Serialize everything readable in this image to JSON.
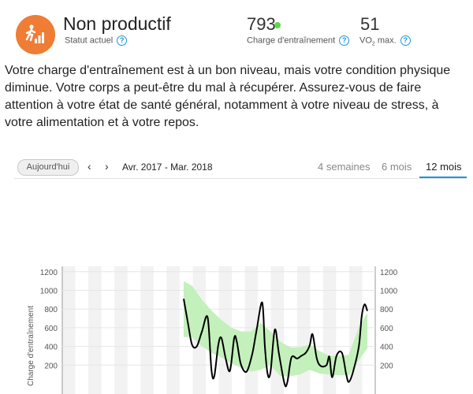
{
  "status": {
    "title": "Non productif",
    "subtitle": "Statut actuel",
    "help": "?"
  },
  "training_load": {
    "value": "793",
    "label": "Charge d'entraînement",
    "dot_color": "#5cd84c",
    "help": "?"
  },
  "vo2": {
    "value": "51",
    "label_prefix": "VO",
    "label_sub": "2",
    "label_suffix": " max.",
    "help": "?"
  },
  "description": "Votre charge d'entraînement est à un bon niveau, mais votre condition physique diminue. Votre corps a peut-être du mal à récupérer. Assurez-vous de faire attention à votre état de santé général, notamment à votre niveau de stress, à votre alimentation et à votre repos.",
  "toolbar": {
    "today_label": "Aujourd'hui",
    "prev_icon": "‹",
    "next_icon": "›",
    "range_label": "Avr. 2017 - Mar. 2018",
    "tabs": [
      {
        "label": "4 semaines",
        "active": false
      },
      {
        "label": "6 mois",
        "active": false
      },
      {
        "label": "12 mois",
        "active": true
      }
    ]
  },
  "chart_data": {
    "type": "line",
    "ylabel": "Charge d'entraînement",
    "ylim": [
      0,
      1300
    ],
    "y_ticks": [
      200,
      400,
      600,
      800,
      1000,
      1200
    ],
    "grid": true,
    "line_color": "#000000",
    "band_color": "#c3f0bb",
    "series": [
      {
        "values": [
          {
            "x": 0.0,
            "y": 910
          },
          {
            "x": 0.018,
            "y": 650
          },
          {
            "x": 0.035,
            "y": 420
          },
          {
            "x": 0.055,
            "y": 400
          },
          {
            "x": 0.077,
            "y": 560
          },
          {
            "x": 0.101,
            "y": 710
          },
          {
            "x": 0.117,
            "y": 150
          },
          {
            "x": 0.129,
            "y": 80
          },
          {
            "x": 0.146,
            "y": 420
          },
          {
            "x": 0.159,
            "y": 490
          },
          {
            "x": 0.177,
            "y": 270
          },
          {
            "x": 0.195,
            "y": 140
          },
          {
            "x": 0.213,
            "y": 490
          },
          {
            "x": 0.224,
            "y": 450
          },
          {
            "x": 0.241,
            "y": 210
          },
          {
            "x": 0.265,
            "y": 130
          },
          {
            "x": 0.289,
            "y": 320
          },
          {
            "x": 0.307,
            "y": 570
          },
          {
            "x": 0.331,
            "y": 870
          },
          {
            "x": 0.342,
            "y": 400
          },
          {
            "x": 0.354,
            "y": 100
          },
          {
            "x": 0.366,
            "y": 130
          },
          {
            "x": 0.384,
            "y": 580
          },
          {
            "x": 0.401,
            "y": 330
          },
          {
            "x": 0.425,
            "y": 0
          },
          {
            "x": 0.437,
            "y": 20
          },
          {
            "x": 0.454,
            "y": 280
          },
          {
            "x": 0.478,
            "y": 270
          },
          {
            "x": 0.496,
            "y": 300
          },
          {
            "x": 0.514,
            "y": 330
          },
          {
            "x": 0.531,
            "y": 410
          },
          {
            "x": 0.543,
            "y": 530
          },
          {
            "x": 0.561,
            "y": 270
          },
          {
            "x": 0.578,
            "y": 190
          },
          {
            "x": 0.602,
            "y": 200
          },
          {
            "x": 0.614,
            "y": 290
          },
          {
            "x": 0.626,
            "y": 70
          },
          {
            "x": 0.644,
            "y": 300
          },
          {
            "x": 0.667,
            "y": 330
          },
          {
            "x": 0.685,
            "y": 100
          },
          {
            "x": 0.696,
            "y": 20
          },
          {
            "x": 0.714,
            "y": 130
          },
          {
            "x": 0.738,
            "y": 400
          },
          {
            "x": 0.75,
            "y": 720
          },
          {
            "x": 0.762,
            "y": 850
          },
          {
            "x": 0.774,
            "y": 780
          }
        ]
      }
    ],
    "band": [
      {
        "x": 0.0,
        "low": 500,
        "high": 1100
      },
      {
        "x": 0.035,
        "low": 500,
        "high": 1050
      },
      {
        "x": 0.077,
        "low": 400,
        "high": 900
      },
      {
        "x": 0.119,
        "low": 330,
        "high": 780
      },
      {
        "x": 0.16,
        "low": 280,
        "high": 680
      },
      {
        "x": 0.201,
        "low": 220,
        "high": 600
      },
      {
        "x": 0.242,
        "low": 170,
        "high": 560
      },
      {
        "x": 0.283,
        "low": 130,
        "high": 560
      },
      {
        "x": 0.325,
        "low": 150,
        "high": 650
      },
      {
        "x": 0.366,
        "low": 200,
        "high": 560
      },
      {
        "x": 0.408,
        "low": 80,
        "high": 450
      },
      {
        "x": 0.449,
        "low": 80,
        "high": 390
      },
      {
        "x": 0.49,
        "low": 100,
        "high": 390
      },
      {
        "x": 0.531,
        "low": 150,
        "high": 420
      },
      {
        "x": 0.572,
        "low": 110,
        "high": 350
      },
      {
        "x": 0.613,
        "low": 100,
        "high": 300
      },
      {
        "x": 0.655,
        "low": 90,
        "high": 300
      },
      {
        "x": 0.696,
        "low": 90,
        "high": 310
      },
      {
        "x": 0.737,
        "low": 250,
        "high": 600
      },
      {
        "x": 0.774,
        "low": 380,
        "high": 760
      }
    ]
  }
}
